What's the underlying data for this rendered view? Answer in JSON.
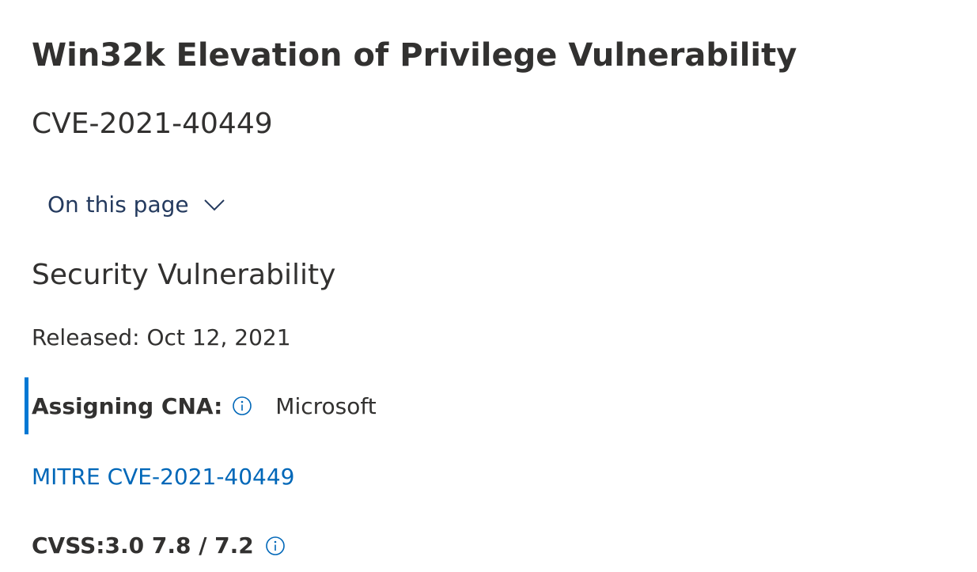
{
  "header": {
    "title": "Win32k Elevation of Privilege Vulnerability",
    "cve_id": "CVE-2021-40449"
  },
  "nav": {
    "on_this_page_label": "On this page",
    "chevron_icon": "chevron-down-icon"
  },
  "security_section": {
    "heading": "Security Vulnerability",
    "released": "Released: Oct 12, 2021",
    "assigning_cna_label": "Assigning CNA:",
    "assigning_cna_value": "Microsoft",
    "info_icon": "info-icon",
    "mitre_link_text": "MITRE CVE-2021-40449",
    "cvss_label": "CVSS:3.0 7.8 / 7.2"
  },
  "colors": {
    "text": "#323130",
    "link": "#0067b8",
    "nav_text": "#243a5e",
    "accent_bar": "#0078d4"
  }
}
